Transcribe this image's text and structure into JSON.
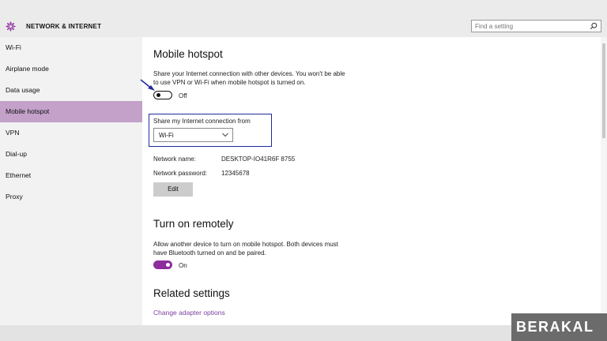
{
  "header": {
    "title": "NETWORK & INTERNET",
    "search_placeholder": "Find a setting"
  },
  "sidebar": {
    "items": [
      {
        "label": "Wi-Fi",
        "active": false
      },
      {
        "label": "Airplane mode",
        "active": false
      },
      {
        "label": "Data usage",
        "active": false
      },
      {
        "label": "Mobile hotspot",
        "active": true
      },
      {
        "label": "VPN",
        "active": false
      },
      {
        "label": "Dial-up",
        "active": false
      },
      {
        "label": "Ethernet",
        "active": false
      },
      {
        "label": "Proxy",
        "active": false
      }
    ]
  },
  "main": {
    "hotspot": {
      "title": "Mobile hotspot",
      "description": "Share your Internet connection with other devices. You won't be able to use VPN or Wi-Fi when mobile hotspot is turned on.",
      "toggle_state": "Off"
    },
    "share": {
      "label": "Share my Internet connection from",
      "selected": "Wi-Fi"
    },
    "network": {
      "name_label": "Network name:",
      "name_value": "DESKTOP-IO41R6F 8755",
      "password_label": "Network password:",
      "password_value": "12345678",
      "edit_label": "Edit"
    },
    "remote": {
      "title": "Turn on remotely",
      "description": "Allow another device to turn on mobile hotspot. Both devices must have Bluetooth turned on and be paired.",
      "toggle_state": "On"
    },
    "related": {
      "title": "Related settings",
      "link": "Change adapter options"
    }
  },
  "watermark": {
    "text": "BERAKAL"
  },
  "colors": {
    "accent": "#8e2c9e",
    "active_nav": "#c3a1c9",
    "highlight_box": "#1f2a9c",
    "link": "#7a3fa0"
  }
}
